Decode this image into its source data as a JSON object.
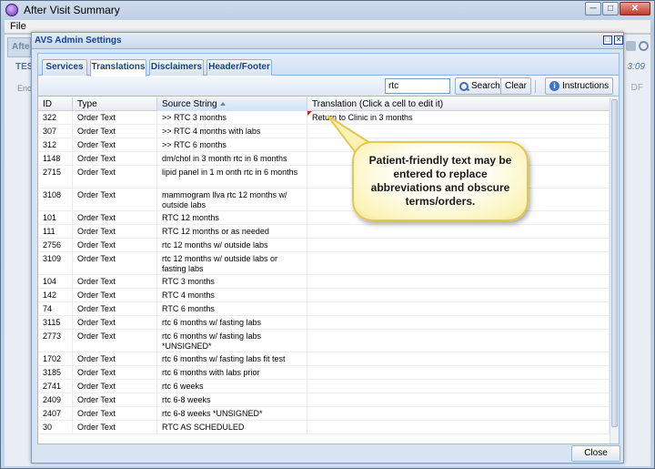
{
  "window": {
    "title": "After Visit Summary",
    "minimize": "─",
    "maximize": "□",
    "close": "✕"
  },
  "menubar": {
    "file": "File"
  },
  "background": {
    "tab": "Afte",
    "label": "TES",
    "enc": "Enc",
    "time": "3:09",
    "df": "DF"
  },
  "dialog": {
    "title": "AVS Admin Settings",
    "restore": "□",
    "close": "✕",
    "tabs": [
      {
        "label": "Services"
      },
      {
        "label": "Translations"
      },
      {
        "label": "Disclaimers"
      },
      {
        "label": "Header/Footer"
      }
    ],
    "toolbar": {
      "search_value": "rtc",
      "search_label": "Search",
      "clear_label": "Clear",
      "instructions_label": "Instructions",
      "info_glyph": "i"
    },
    "columns": {
      "id": "ID",
      "type": "Type",
      "source": "Source String",
      "translation": "Translation (Click a cell to edit it)"
    },
    "rows": [
      {
        "id": "322",
        "type": "Order Text",
        "source": ">> RTC 3 months",
        "translation": "Return to Clinic in 3 months"
      },
      {
        "id": "307",
        "type": "Order Text",
        "source": ">> RTC 4 months with labs",
        "translation": ""
      },
      {
        "id": "312",
        "type": "Order Text",
        "source": ">> RTC 6 months",
        "translation": ""
      },
      {
        "id": "1148",
        "type": "Order Text",
        "source": "dm/chol in 3 month rtc in 6 months",
        "translation": ""
      },
      {
        "id": "2715",
        "type": "Order Text",
        "source": "lipid panel in 1 m onth rtc in 6 months",
        "translation": ""
      },
      {
        "id": "3108",
        "type": "Order Text",
        "source": "mammogram llva rtc 12 months w/ outside labs",
        "translation": ""
      },
      {
        "id": "101",
        "type": "Order Text",
        "source": "RTC 12 months",
        "translation": ""
      },
      {
        "id": "111",
        "type": "Order Text",
        "source": "RTC 12 months or as needed",
        "translation": ""
      },
      {
        "id": "2756",
        "type": "Order Text",
        "source": "rtc 12 months w/ outside labs",
        "translation": ""
      },
      {
        "id": "3109",
        "type": "Order Text",
        "source": "rtc 12 months w/ outside labs or fasting labs",
        "translation": ""
      },
      {
        "id": "104",
        "type": "Order Text",
        "source": "RTC 3 months",
        "translation": ""
      },
      {
        "id": "142",
        "type": "Order Text",
        "source": "RTC 4 months",
        "translation": ""
      },
      {
        "id": "74",
        "type": "Order Text",
        "source": "RTC 6 months",
        "translation": ""
      },
      {
        "id": "3115",
        "type": "Order Text",
        "source": "rtc 6 months w/ fasting labs",
        "translation": ""
      },
      {
        "id": "2773",
        "type": "Order Text",
        "source": "rtc 6 months w/ fasting labs *UNSIGNED*",
        "translation": ""
      },
      {
        "id": "1702",
        "type": "Order Text",
        "source": "rtc 6 months w/ fasting labs fit test",
        "translation": ""
      },
      {
        "id": "3185",
        "type": "Order Text",
        "source": "rtc 6 months with labs prior",
        "translation": ""
      },
      {
        "id": "2741",
        "type": "Order Text",
        "source": "rtc 6 weeks",
        "translation": ""
      },
      {
        "id": "2409",
        "type": "Order Text",
        "source": "rtc 6-8 weeks",
        "translation": ""
      },
      {
        "id": "2407",
        "type": "Order Text",
        "source": "rtc 6-8 weeks *UNSIGNED*",
        "translation": ""
      },
      {
        "id": "30",
        "type": "Order Text",
        "source": "RTC AS SCHEDULED",
        "translation": ""
      }
    ],
    "close_label": "Close"
  },
  "callout": {
    "text": "Patient-friendly text may be entered to replace abbreviations and obscure terms/orders."
  },
  "colors": {
    "accent": "#15428b",
    "callout_fill": "#fbf3b6",
    "callout_border": "#e7c74a",
    "dirty_marker": "#d41f1f"
  }
}
